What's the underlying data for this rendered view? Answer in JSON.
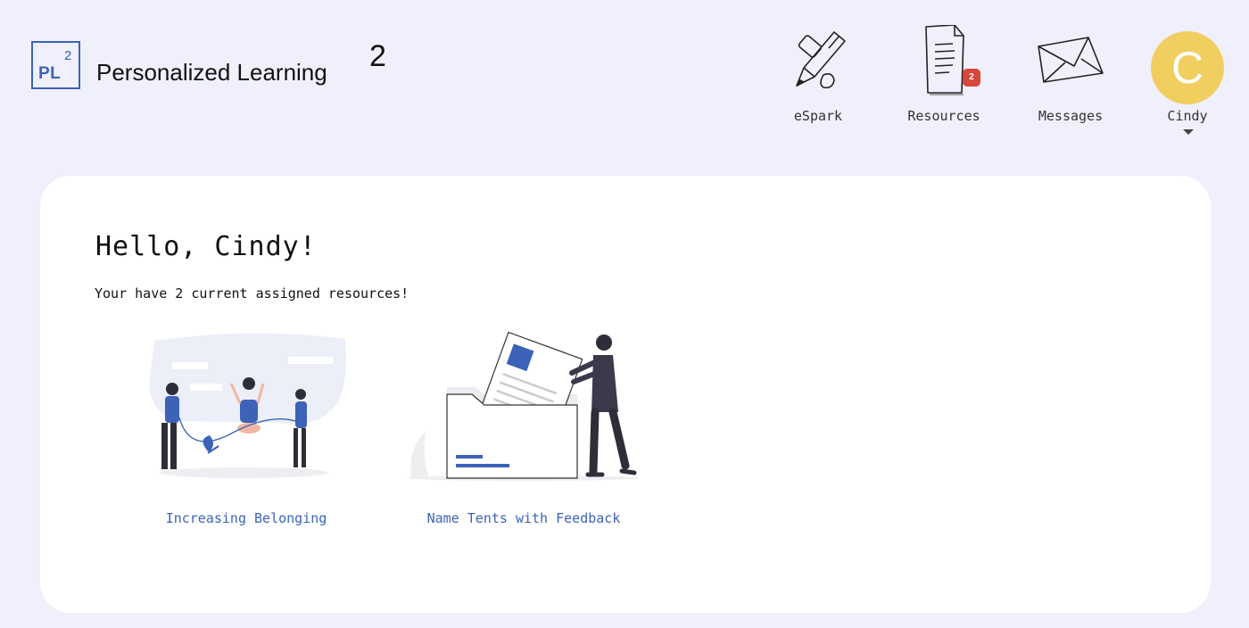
{
  "header": {
    "logo_text": "PL",
    "logo_superscript": "2",
    "title": "Personalized Learning",
    "title_superscript": "2"
  },
  "nav": {
    "items": [
      {
        "label": "eSpark",
        "icon": "pencil-icon"
      },
      {
        "label": "Resources",
        "icon": "document-icon",
        "badge": "2"
      },
      {
        "label": "Messages",
        "icon": "envelope-icon"
      }
    ],
    "user": {
      "initial": "C",
      "name": "Cindy",
      "avatar_color": "#f0cf60"
    }
  },
  "main": {
    "greeting": "Hello, Cindy!",
    "subtext": "Your have 2 current assigned resources!",
    "resources": [
      {
        "title": "Increasing Belonging",
        "illustration": "children-jump-rope-illustration"
      },
      {
        "title": "Name Tents with Feedback",
        "illustration": "person-filing-document-illustration"
      }
    ]
  },
  "colors": {
    "background": "#eff0fb",
    "accent": "#3c63b8",
    "badge": "#d9463a",
    "card": "#ffffff"
  }
}
